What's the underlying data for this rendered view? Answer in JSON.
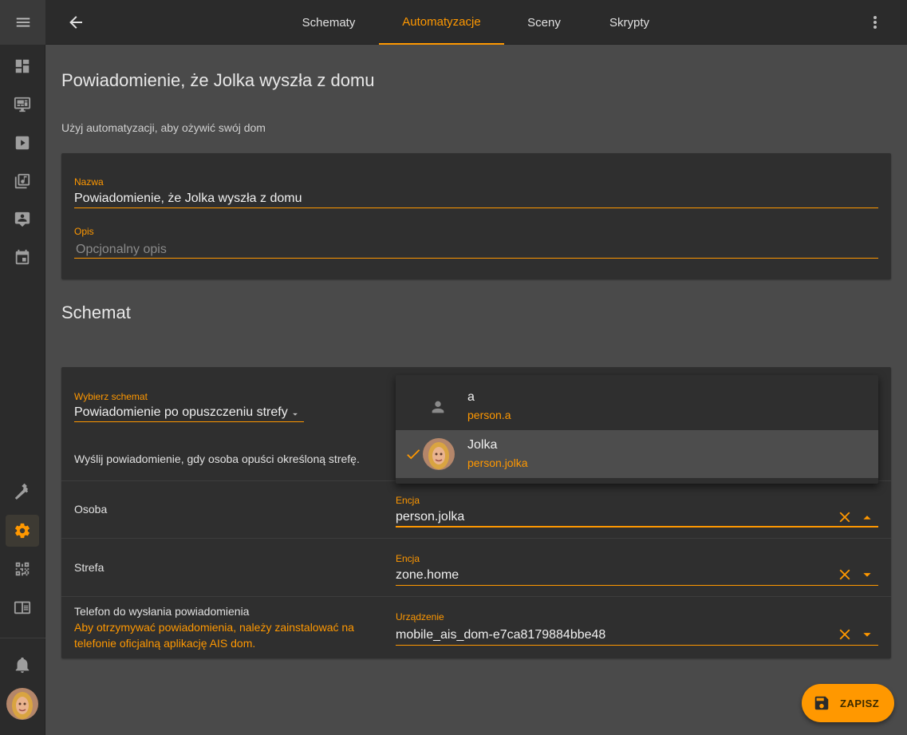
{
  "header": {
    "tabs": [
      {
        "label": "Schematy"
      },
      {
        "label": "Automatyzacje"
      },
      {
        "label": "Sceny"
      },
      {
        "label": "Skrypty"
      }
    ]
  },
  "page": {
    "title": "Powiadomienie, że Jolka wyszła z domu",
    "description": "Użyj automatyzacji, aby ożywić swój dom"
  },
  "info_card": {
    "name_label": "Nazwa",
    "name_value": "Powiadomienie, że Jolka wyszła z domu",
    "desc_label": "Opis",
    "desc_placeholder": "Opcjonalny opis"
  },
  "blueprint": {
    "section_title": "Schemat",
    "select_label": "Wybierz schemat",
    "select_value": "Powiadomienie po opuszczeniu strefy",
    "description": "Wyślij powiadomienie, gdy osoba opuści określoną strefę.",
    "rows": [
      {
        "label": "Osoba",
        "field_label": "Encja",
        "value": "person.jolka"
      },
      {
        "label": "Strefa",
        "field_label": "Encja",
        "value": "zone.home"
      },
      {
        "label": "Telefon do wysłania powiadomienia",
        "note": "Aby otrzymywać powiadomienia, należy zainstalować na telefonie oficjalną aplikację AIS dom.",
        "field_label": "Urządzenie",
        "value": "mobile_ais_dom-e7ca8179884bbe48"
      }
    ]
  },
  "dropdown": {
    "options": [
      {
        "title": "a",
        "subtitle": "person.a",
        "selected": false,
        "icon": "account-icon"
      },
      {
        "title": "Jolka",
        "subtitle": "person.jolka",
        "selected": true,
        "icon": "avatar"
      }
    ]
  },
  "fab": {
    "label": "ZAPISZ"
  },
  "colors": {
    "accent": "#ff9800",
    "background": "#4a4a4a",
    "card": "#2f2f2f",
    "sidebar": "#2b2b2b"
  }
}
